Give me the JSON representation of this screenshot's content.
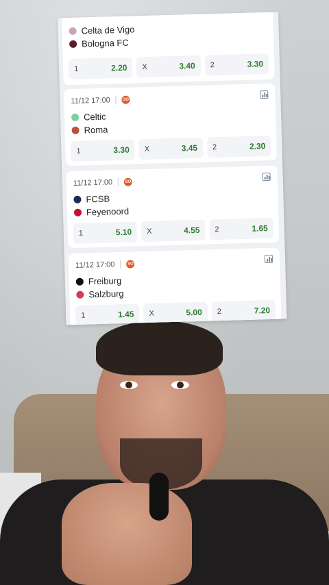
{
  "matches": [
    {
      "date": "",
      "home": "Celta de Vigo",
      "away": "Bologna FC",
      "home_crest": "#c9a7b4",
      "away_crest": "#5a1f2a",
      "odds": [
        {
          "k": "1",
          "v": "2.20"
        },
        {
          "k": "X",
          "v": "3.40"
        },
        {
          "k": "2",
          "v": "3.30"
        }
      ]
    },
    {
      "date": "11/12 17:00",
      "home": "Celtic",
      "away": "Roma",
      "home_crest": "#7fcf9c",
      "away_crest": "#b7533a",
      "odds": [
        {
          "k": "1",
          "v": "3.30"
        },
        {
          "k": "X",
          "v": "3.45"
        },
        {
          "k": "2",
          "v": "2.30"
        }
      ]
    },
    {
      "date": "11/12 17:00",
      "home": "FCSB",
      "away": "Feyenoord",
      "home_crest": "#1e2a55",
      "away_crest": "#c8102e",
      "odds": [
        {
          "k": "1",
          "v": "5.10"
        },
        {
          "k": "X",
          "v": "4.55"
        },
        {
          "k": "2",
          "v": "1.65"
        }
      ]
    },
    {
      "date": "11/12 17:00",
      "home": "Freiburg",
      "away": "Salzburg",
      "home_crest": "#111111",
      "away_crest": "#d63b5a",
      "odds": [
        {
          "k": "1",
          "v": "1.45"
        },
        {
          "k": "X",
          "v": "5.00"
        },
        {
          "k": "2",
          "v": "7.20"
        }
      ]
    }
  ],
  "badge": "SO",
  "icons": {
    "stats": "bar-chart-icon",
    "live": "live-badge-icon"
  }
}
